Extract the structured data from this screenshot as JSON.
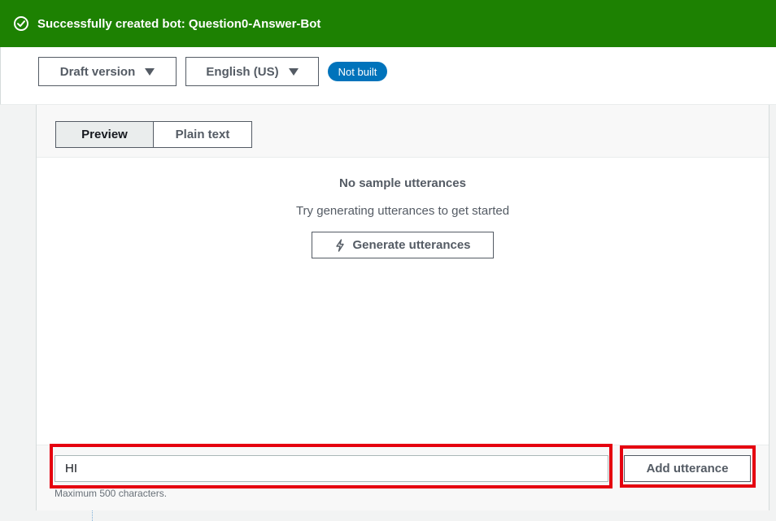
{
  "flash": {
    "message": "Successfully created bot: Question0-Answer-Bot",
    "icon": "check-circle-icon",
    "color": "#1d8102"
  },
  "toolbar": {
    "version_select": {
      "value": "Draft version"
    },
    "language_select": {
      "value": "English (US)"
    },
    "status_badge": {
      "label": "Not built",
      "color": "#0073bb"
    }
  },
  "utterances": {
    "view_toggle": {
      "preview_label": "Preview",
      "plain_text_label": "Plain text",
      "selected": "Preview"
    },
    "empty_state": {
      "title": "No sample utterances",
      "subtitle": "Try generating utterances to get started",
      "generate_button_label": "Generate utterances",
      "generate_icon": "lightning-icon"
    },
    "input": {
      "value": "HI",
      "hint": "Maximum 500 characters."
    },
    "add_button_label": "Add utterance"
  },
  "highlight_color": "#e5000f"
}
